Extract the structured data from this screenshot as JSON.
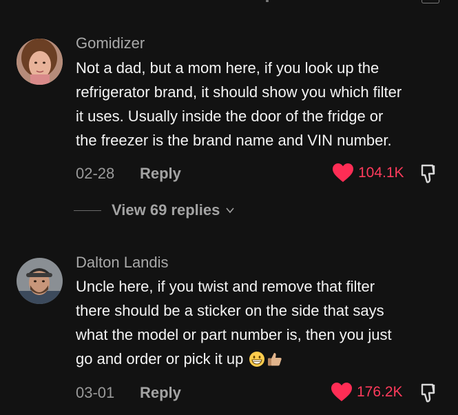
{
  "comments": [
    {
      "username": "Gomidizer",
      "text_lines": [
        "Not a dad, but a mom here, if you look up the",
        "refrigerator brand, it should show you which filter",
        "it uses. Usually inside the door of the fridge or",
        "the freezer is the brand name and VIN number."
      ],
      "date": "02-28",
      "reply_label": "Reply",
      "likes": "104.1K",
      "like_color": "#ff3b5c"
    },
    {
      "username": "Dalton Landis",
      "text_lines": [
        "Uncle here, if you twist and remove that filter",
        "there should be a sticker on the side that says",
        "what the model or part number is, then you just",
        "go and order or pick it up"
      ],
      "emojis": [
        "grinning-face-icon",
        "thumbs-up-icon"
      ],
      "date": "03-01",
      "reply_label": "Reply",
      "likes": "176.2K",
      "like_color": "#ff3b5c"
    }
  ],
  "view_replies_label": "View 69 replies"
}
